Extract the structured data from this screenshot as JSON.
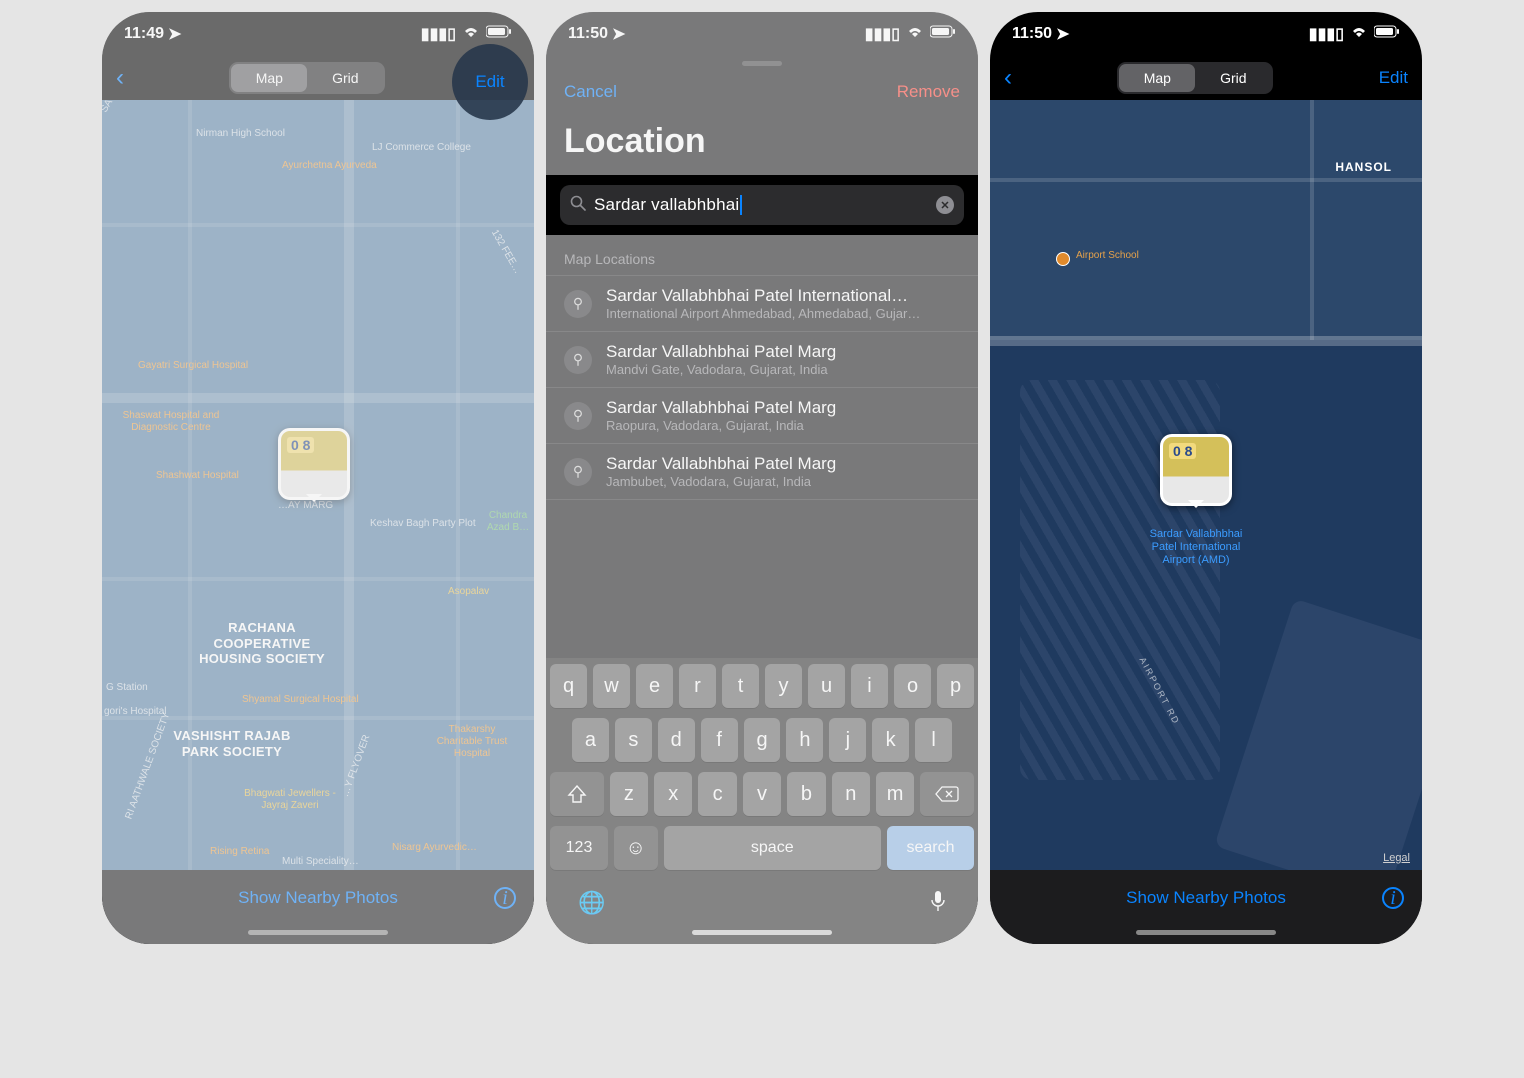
{
  "phone1": {
    "time": "11:49",
    "edit": "Edit",
    "tabs": {
      "map": "Map",
      "grid": "Grid"
    },
    "nearby": "Show Nearby Photos",
    "map_labels": {
      "nirman": "Nirman High School",
      "ayurchetna": "Ayurchetna Ayurveda",
      "lj": "LJ Commerce College",
      "gayatri": "Gayatri Surgical Hospital",
      "shaswat": "Shaswat Hospital and Diagnostic Centre",
      "shashwat": "Shashwat Hospital",
      "keshav": "Keshav Bagh Party Plot",
      "chandra": "Chandra Azad B…",
      "asopalav": "Asopalav",
      "rachana": "RACHANA COOPERATIVE HOUSING SOCIETY",
      "shyamal": "Shyamal Surgical Hospital",
      "vashisht": "VASHISHT RAJAB PARK SOCIETY",
      "thakarshy": "Thakarshy Charitable Trust Hospital",
      "bhagwati": "Bhagwati Jewellers - Jayraj Zaveri",
      "nisarg": "Nisarg Ayurvedic…",
      "rising": "Rising Retina",
      "station": "G Station",
      "gori": "gori's Hospital",
      "dholaki": "SATYA DILEEP DHOLAKI…",
      "feet": "132 FEE…",
      "marg": "…AY MARG",
      "flyover": "…Y FLYOVER",
      "aathwale": "RI AATHWALE SOCIETY",
      "multi": "Multi Speciality…"
    }
  },
  "phone2": {
    "time": "11:50",
    "cancel": "Cancel",
    "remove": "Remove",
    "title": "Location",
    "search_value": "Sardar vallabhbhai",
    "list_header": "Map Locations",
    "results": [
      {
        "title": "Sardar Vallabhbhai Patel International…",
        "sub": "International Airport Ahmedabad, Ahmedabad, Gujar…"
      },
      {
        "title": "Sardar Vallabhbhai Patel Marg",
        "sub": "Mandvi Gate, Vadodara, Gujarat, India"
      },
      {
        "title": "Sardar Vallabhbhai Patel Marg",
        "sub": "Raopura, Vadodara, Gujarat, India"
      },
      {
        "title": "Sardar Vallabhbhai Patel Marg",
        "sub": "Jambubet, Vadodara, Gujarat, India"
      }
    ],
    "keys": {
      "r1": [
        "q",
        "w",
        "e",
        "r",
        "t",
        "y",
        "u",
        "i",
        "o",
        "p"
      ],
      "r2": [
        "a",
        "s",
        "d",
        "f",
        "g",
        "h",
        "j",
        "k",
        "l"
      ],
      "r3": [
        "z",
        "x",
        "c",
        "v",
        "b",
        "n",
        "m"
      ],
      "num": "123",
      "space": "space",
      "search": "search"
    }
  },
  "phone3": {
    "time": "11:50",
    "edit": "Edit",
    "tabs": {
      "map": "Map",
      "grid": "Grid"
    },
    "nearby": "Show Nearby Photos",
    "legal": "Legal",
    "hansol": "HANSOL",
    "airport_school": "Airport School",
    "airport_road": "AIRPORT RD",
    "pin_label": "Sardar Vallabhbhai Patel International Airport (AMD)"
  }
}
